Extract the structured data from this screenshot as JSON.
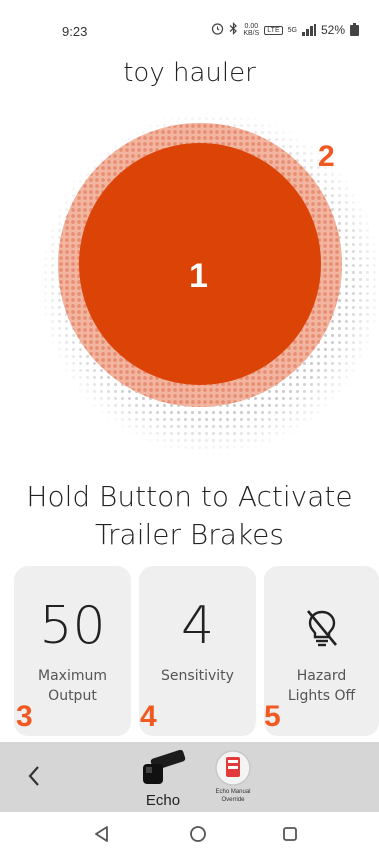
{
  "status_bar": {
    "time": "9:23",
    "net_speed_value": "0.00",
    "net_speed_unit": "KB/S",
    "lte_label": "LTE",
    "fiveg_label": "5G",
    "battery_percent": "52%"
  },
  "page": {
    "title": "toy hauler",
    "instruction_line1": "Hold Button to Activate",
    "instruction_line2": "Trailer Brakes"
  },
  "brake_button": {
    "color": "#dc4306",
    "ring_color": "#f2b5a0"
  },
  "callouts": {
    "one": "1",
    "two": "2",
    "three": "3",
    "four": "4",
    "five": "5",
    "color": "#f05a22"
  },
  "cards": {
    "max_output": {
      "value": "50",
      "label_line1": "Maximum",
      "label_line2": "Output"
    },
    "sensitivity": {
      "value": "4",
      "label_line1": "Sensitivity"
    },
    "hazard": {
      "icon": "lightbulb-off-icon",
      "label_line1": "Hazard",
      "label_line2": "Lights Off"
    }
  },
  "device_bar": {
    "back_icon": "chevron-left-icon",
    "echo_label": "Echo",
    "override_label_line1": "Echo Manual",
    "override_label_line2": "Override"
  },
  "nav_bar": {
    "back": "triangle-back-icon",
    "home": "circle-home-icon",
    "recents": "square-recents-icon"
  }
}
